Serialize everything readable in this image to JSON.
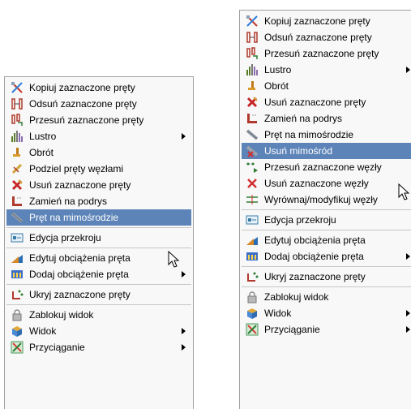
{
  "left_menu": {
    "items": [
      {
        "label": "Kopiuj zaznaczone pręty",
        "icon": "copy-bars-icon"
      },
      {
        "label": "Odsuń zaznaczone pręty",
        "icon": "offset-bars-icon"
      },
      {
        "label": "Przesuń zaznaczone pręty",
        "icon": "move-bars-icon"
      },
      {
        "label": "Lustro",
        "icon": "mirror-icon"
      },
      {
        "label": "Obrót",
        "icon": "rotate-icon"
      },
      {
        "label": "Podziel pręty węzłami",
        "icon": "divide-bars-icon"
      },
      {
        "label": "Usuń zaznaczone pręty",
        "icon": "delete-bars-icon"
      },
      {
        "label": "Zamień na podrys",
        "icon": "convert-underlay-icon"
      },
      {
        "label": "Pręt na mimośrodzie",
        "icon": "eccentric-bar-icon"
      },
      {
        "label": "Edycja przekroju",
        "icon": "section-edit-icon"
      },
      {
        "label": "Edytuj obciążenia pręta",
        "icon": "edit-loads-icon"
      },
      {
        "label": "Dodaj obciążenie pręta",
        "icon": "add-load-icon"
      },
      {
        "label": "Ukryj zaznaczone pręty",
        "icon": "hide-bars-icon"
      },
      {
        "label": "Zablokuj widok",
        "icon": "lock-view-icon"
      },
      {
        "label": "Widok",
        "icon": "view-icon"
      },
      {
        "label": "Przyciąganie",
        "icon": "snap-icon"
      }
    ]
  },
  "right_menu": {
    "items": [
      {
        "label": "Kopiuj zaznaczone pręty",
        "icon": "copy-bars-icon"
      },
      {
        "label": "Odsuń zaznaczone pręty",
        "icon": "offset-bars-icon"
      },
      {
        "label": "Przesuń zaznaczone pręty",
        "icon": "move-bars-icon"
      },
      {
        "label": "Lustro",
        "icon": "mirror-icon"
      },
      {
        "label": "Obrót",
        "icon": "rotate-icon"
      },
      {
        "label": "Usuń zaznaczone pręty",
        "icon": "delete-bars-icon"
      },
      {
        "label": "Zamień na podrys",
        "icon": "convert-underlay-icon"
      },
      {
        "label": "Pręt na mimośrodzie",
        "icon": "eccentric-bar-icon"
      },
      {
        "label": "Usuń mimośród",
        "icon": "remove-eccentric-icon"
      },
      {
        "label": "Przesuń zaznaczone węzły",
        "icon": "move-nodes-icon"
      },
      {
        "label": "Usuń zaznaczone węzły",
        "icon": "delete-nodes-icon"
      },
      {
        "label": "Wyrównaj/modyfikuj węzły",
        "icon": "align-nodes-icon"
      },
      {
        "label": "Edycja przekroju",
        "icon": "section-edit-icon"
      },
      {
        "label": "Edytuj obciążenia pręta",
        "icon": "edit-loads-icon"
      },
      {
        "label": "Dodaj obciążenie pręta",
        "icon": "add-load-icon"
      },
      {
        "label": "Ukryj zaznaczone pręty",
        "icon": "hide-bars-icon"
      },
      {
        "label": "Zablokuj widok",
        "icon": "lock-view-icon"
      },
      {
        "label": "Widok",
        "icon": "view-icon"
      },
      {
        "label": "Przyciąganie",
        "icon": "snap-icon"
      }
    ]
  },
  "colors": {
    "highlight": "#5d84b8",
    "menu_bg": "#f8f8f8",
    "border": "#a0a0a0"
  }
}
